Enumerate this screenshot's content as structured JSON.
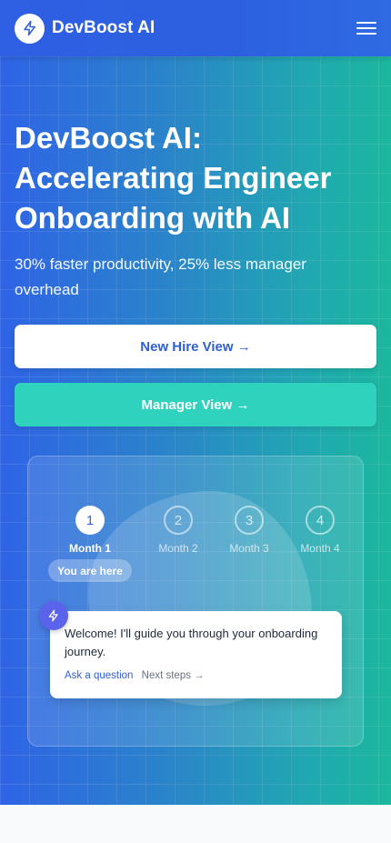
{
  "header": {
    "brand": "DevBoost AI",
    "logo_icon": "bolt-icon",
    "menu_icon": "hamburger-menu-icon"
  },
  "hero": {
    "title": "DevBoost AI: Accelerating Engineer Onboarding with AI",
    "subtitle": "30% faster productivity, 25% less manager overhead",
    "buttons": {
      "new_hire": "New Hire View →",
      "manager": "Manager View →"
    }
  },
  "journey": {
    "steps": [
      {
        "number": "1",
        "label": "Month 1",
        "state": "active"
      },
      {
        "number": "2",
        "label": "Month 2",
        "state": "inactive"
      },
      {
        "number": "3",
        "label": "Month 3",
        "state": "inactive"
      },
      {
        "number": "4",
        "label": "Month 4",
        "state": "inactive"
      }
    ],
    "current_badge": "You are here",
    "chat": {
      "message": "Welcome! I'll guide you through your onboarding journey.",
      "link_ask": "Ask a question",
      "link_next": "Next steps →",
      "bot_icon": "bolt-icon"
    }
  },
  "colors": {
    "primary": "#2f5fe3",
    "teal": "#2fd3bd",
    "bot_badge": "#5b63ec"
  }
}
